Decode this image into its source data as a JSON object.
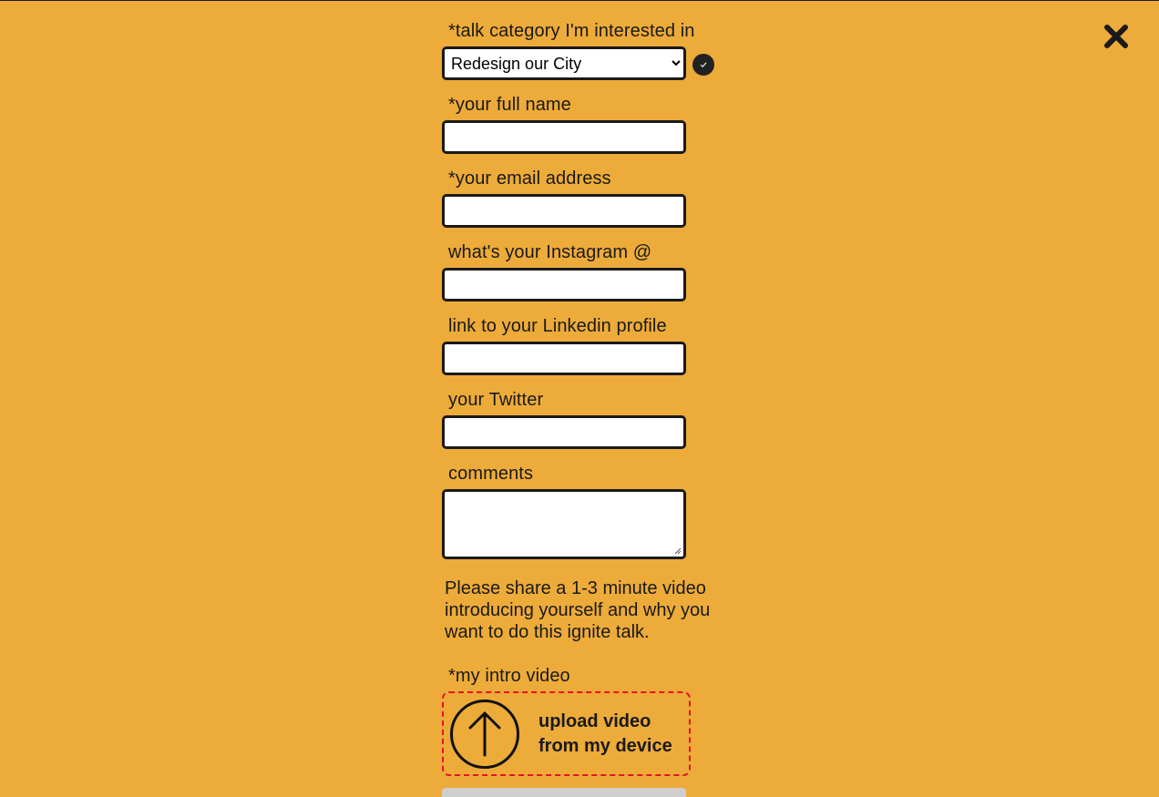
{
  "close": {
    "icon": "close-x-icon"
  },
  "form": {
    "category": {
      "label": "*talk category I'm interested in",
      "selected": "Redesign our City",
      "valid_icon": "checkmark-icon"
    },
    "full_name": {
      "label": "*your full name",
      "value": ""
    },
    "email": {
      "label": "*your email address",
      "value": ""
    },
    "instagram": {
      "label": "what's your Instagram @",
      "value": ""
    },
    "linkedin": {
      "label": "link to your Linkedin profile",
      "value": ""
    },
    "twitter": {
      "label": "your Twitter",
      "value": ""
    },
    "comments": {
      "label": "comments",
      "value": ""
    },
    "video_info": "Please share a 1-3 minute video introducing yourself and why you want to do this ignite talk.",
    "video": {
      "label": "*my intro video",
      "upload_line1": "upload video",
      "upload_line2": "from my device",
      "upload_icon": "upload-arrow-icon"
    }
  },
  "colors": {
    "background": "#EDAB3A",
    "border": "#1A1A1A",
    "upload_border": "#E8141E"
  }
}
